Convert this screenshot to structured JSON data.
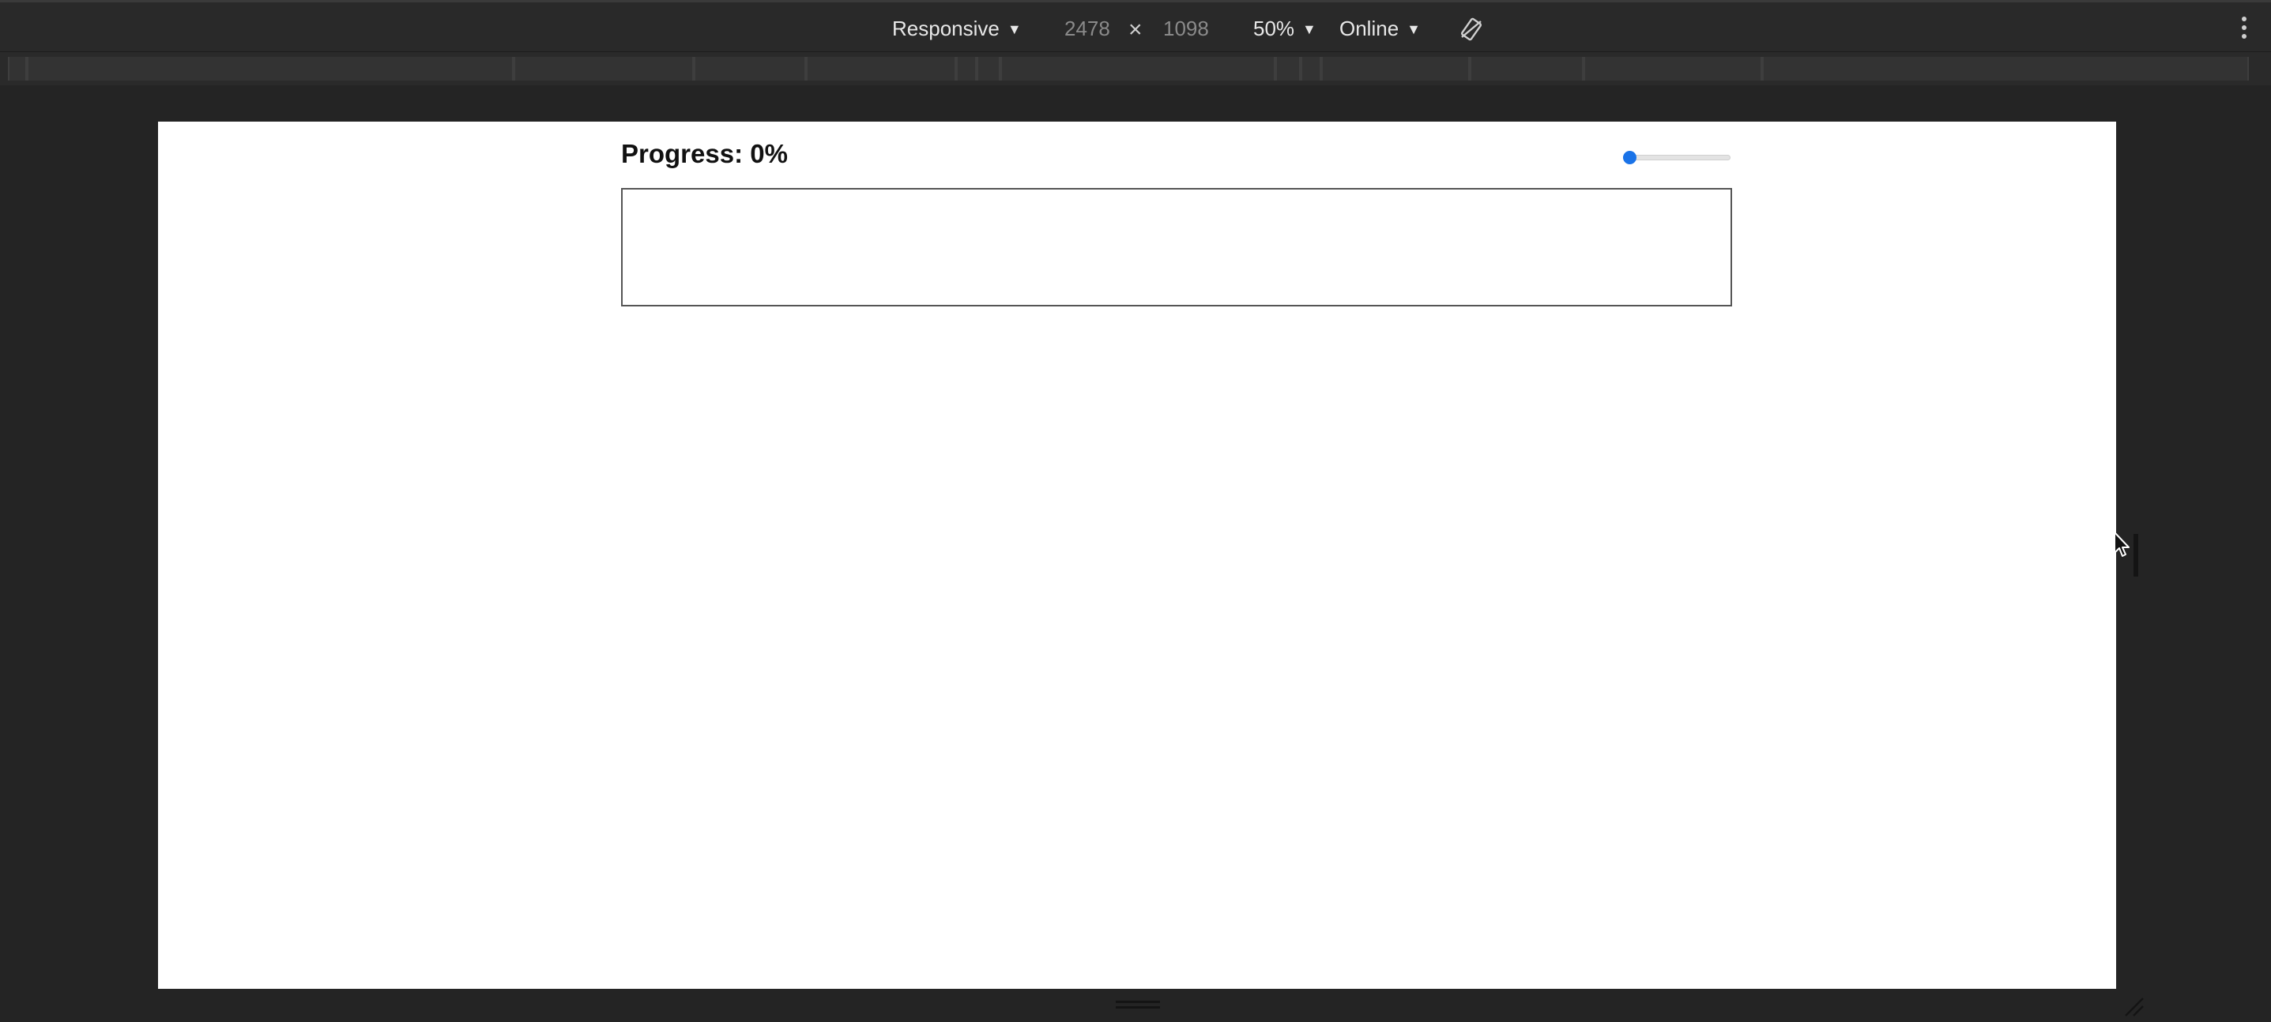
{
  "toolbar": {
    "device_label": "Responsive",
    "width_value": "2478",
    "times": "×",
    "height_value": "1098",
    "zoom_label": "50%",
    "throttle_label": "Online",
    "rotate_icon": "rotate-icon",
    "more_icon": "kebab-menu-icon"
  },
  "page": {
    "heading": "Progress: 0%",
    "slider": {
      "value": 0,
      "min": 0,
      "max": 100,
      "accent_color": "#1a73e8"
    }
  }
}
